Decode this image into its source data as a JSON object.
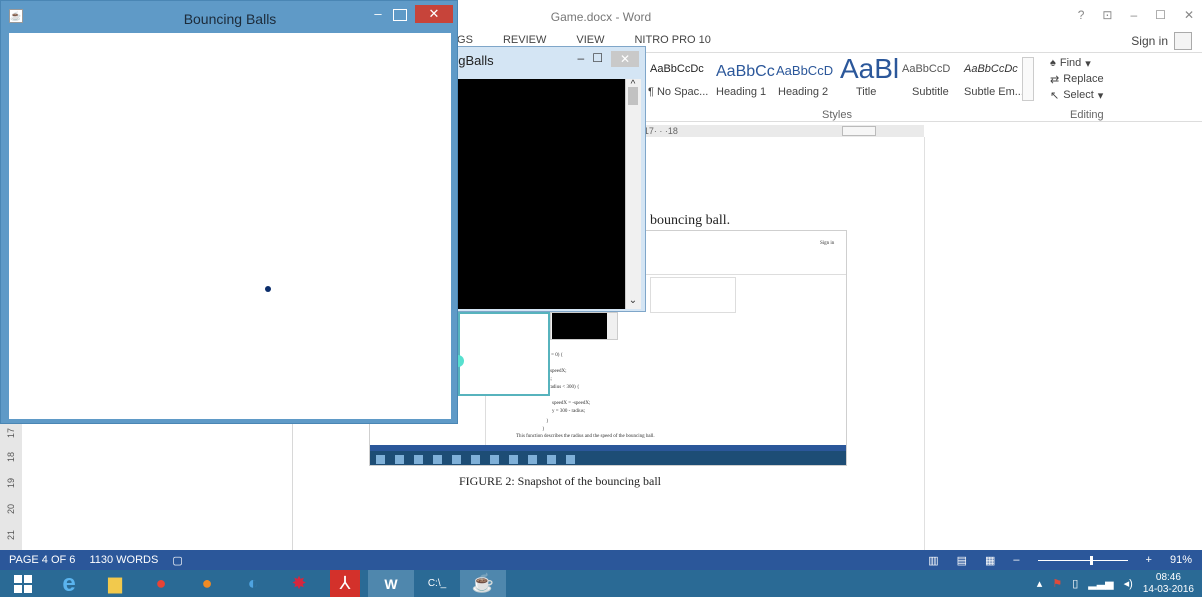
{
  "java_window": {
    "title": "Bouncing Balls",
    "minimize": "–",
    "close": "✕"
  },
  "back_java_window": {
    "title": "ngBalls",
    "minimize": "–",
    "maximize": "☐",
    "close": "✕",
    "scroll_up": "^",
    "scroll_down": "⌄"
  },
  "word": {
    "title": "Game.docx - Word",
    "window_controls": [
      "?",
      "⊡",
      "–",
      "☐",
      "✕"
    ],
    "sign_in": "Sign in",
    "tabs": [
      "IGS",
      "REVIEW",
      "VIEW",
      "NITRO PRO 10"
    ],
    "styles": [
      {
        "preview": "AaBbCcDc",
        "name": "¶ No Spac..."
      },
      {
        "preview": "AaBbCc",
        "name": "Heading 1"
      },
      {
        "preview": "AaBbCcD",
        "name": "Heading 2"
      },
      {
        "preview": "AaBl",
        "name": "Title"
      },
      {
        "preview": "AaBbCcD",
        "name": "Subtitle"
      },
      {
        "preview": "AaBbCcDc",
        "name": "Subtle Em..."
      }
    ],
    "styles_label": "Styles",
    "editing": {
      "find": "Find",
      "replace": "Replace",
      "select": "Select",
      "label": "Editing"
    },
    "ruler": "· ·10· · ·11· · ·12· · ·13· · ·14· · ·15· · ·16· · ·17· · ·18",
    "vertical_ruler": [
      "17",
      "18",
      "19",
      "20",
      "21"
    ],
    "doc_text": "bouncing ball.",
    "caption": "FIGURE 2: Snapshot of the bouncing ball",
    "snapshot": {
      "code_lines": [
        "m = 0) {",
        "= speedX;",
        "us;",
        "- radius < 300) {",
        "speedX = -speedX;",
        "y = 300 - radius;",
        "}",
        "}"
      ],
      "description": "This function describes the radius and the speed of the bouncing ball.",
      "sign_in": "Sign in"
    },
    "status": {
      "page": "PAGE 4 OF 6",
      "words": "1130 WORDS",
      "zoom": "91%",
      "zoom_minus": "–",
      "zoom_plus": "+"
    }
  },
  "taskbar": {
    "apps": [
      "start",
      "internet-explorer",
      "file-explorer",
      "chrome",
      "firefox",
      "ccleaner",
      "game-app",
      "acrobat",
      "word",
      "command-prompt",
      "java"
    ],
    "time": "08:46",
    "date": "14-03-2016"
  }
}
